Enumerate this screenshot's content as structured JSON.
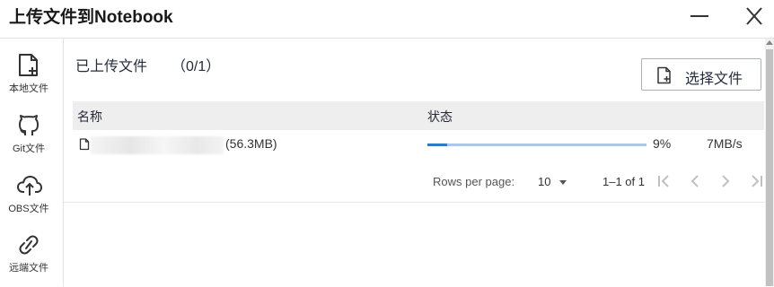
{
  "window": {
    "title": "上传文件到Notebook",
    "minimize_icon": "minimize-icon",
    "close_icon": "close-icon"
  },
  "sidebar": {
    "items": [
      {
        "label": "本地文件",
        "icon": "local-file-add-icon"
      },
      {
        "label": "Git文件",
        "icon": "github-icon"
      },
      {
        "label": "OBS文件",
        "icon": "cloud-upload-icon"
      },
      {
        "label": "远端文件",
        "icon": "link-icon"
      }
    ]
  },
  "main": {
    "uploaded_title": "已上传文件",
    "uploaded_count": "（0/1）",
    "select_button_label": "选择文件",
    "select_button_icon": "file-add-icon",
    "table": {
      "headers": {
        "name": "名称",
        "status": "状态"
      },
      "rows": [
        {
          "file_size": "(56.3MB)",
          "progress_percent": 9,
          "progress_label": "9%",
          "speed": "7MB/s"
        }
      ]
    },
    "pagination": {
      "rows_per_page_label": "Rows per page:",
      "rows_per_page_value": "10",
      "range": "1–1 of 1"
    }
  },
  "colors": {
    "progress_fill": "#2f79c8",
    "progress_track": "#a9c8ea",
    "header_bg": "#eeeeee"
  }
}
